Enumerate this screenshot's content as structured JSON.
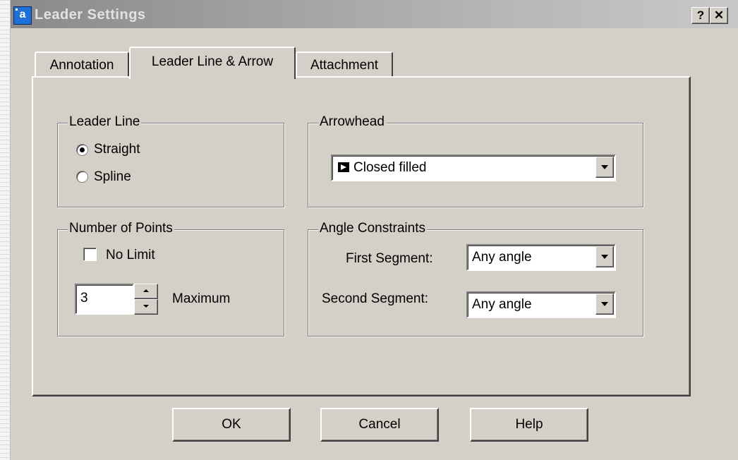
{
  "window": {
    "title": "Leader Settings",
    "help_button": "?",
    "close_button": "✕"
  },
  "tabs": [
    {
      "label": "Annotation",
      "active": false
    },
    {
      "label": "Leader Line & Arrow",
      "active": true
    },
    {
      "label": "Attachment",
      "active": false
    }
  ],
  "leader_line": {
    "title": "Leader Line",
    "options": [
      {
        "label": "Straight",
        "checked": true
      },
      {
        "label": "Spline",
        "checked": false
      }
    ]
  },
  "arrowhead": {
    "title": "Arrowhead",
    "selected": "Closed filled",
    "icon": "closed-filled-arrow-icon"
  },
  "number_of_points": {
    "title": "Number of Points",
    "no_limit_label": "No Limit",
    "no_limit_checked": false,
    "value": "3",
    "maximum_label": "Maximum"
  },
  "angle_constraints": {
    "title": "Angle Constraints",
    "first_label": "First Segment:",
    "first_value": "Any angle",
    "second_label": "Second Segment:",
    "second_value": "Any angle"
  },
  "buttons": {
    "ok": "OK",
    "cancel": "Cancel",
    "help": "Help"
  }
}
